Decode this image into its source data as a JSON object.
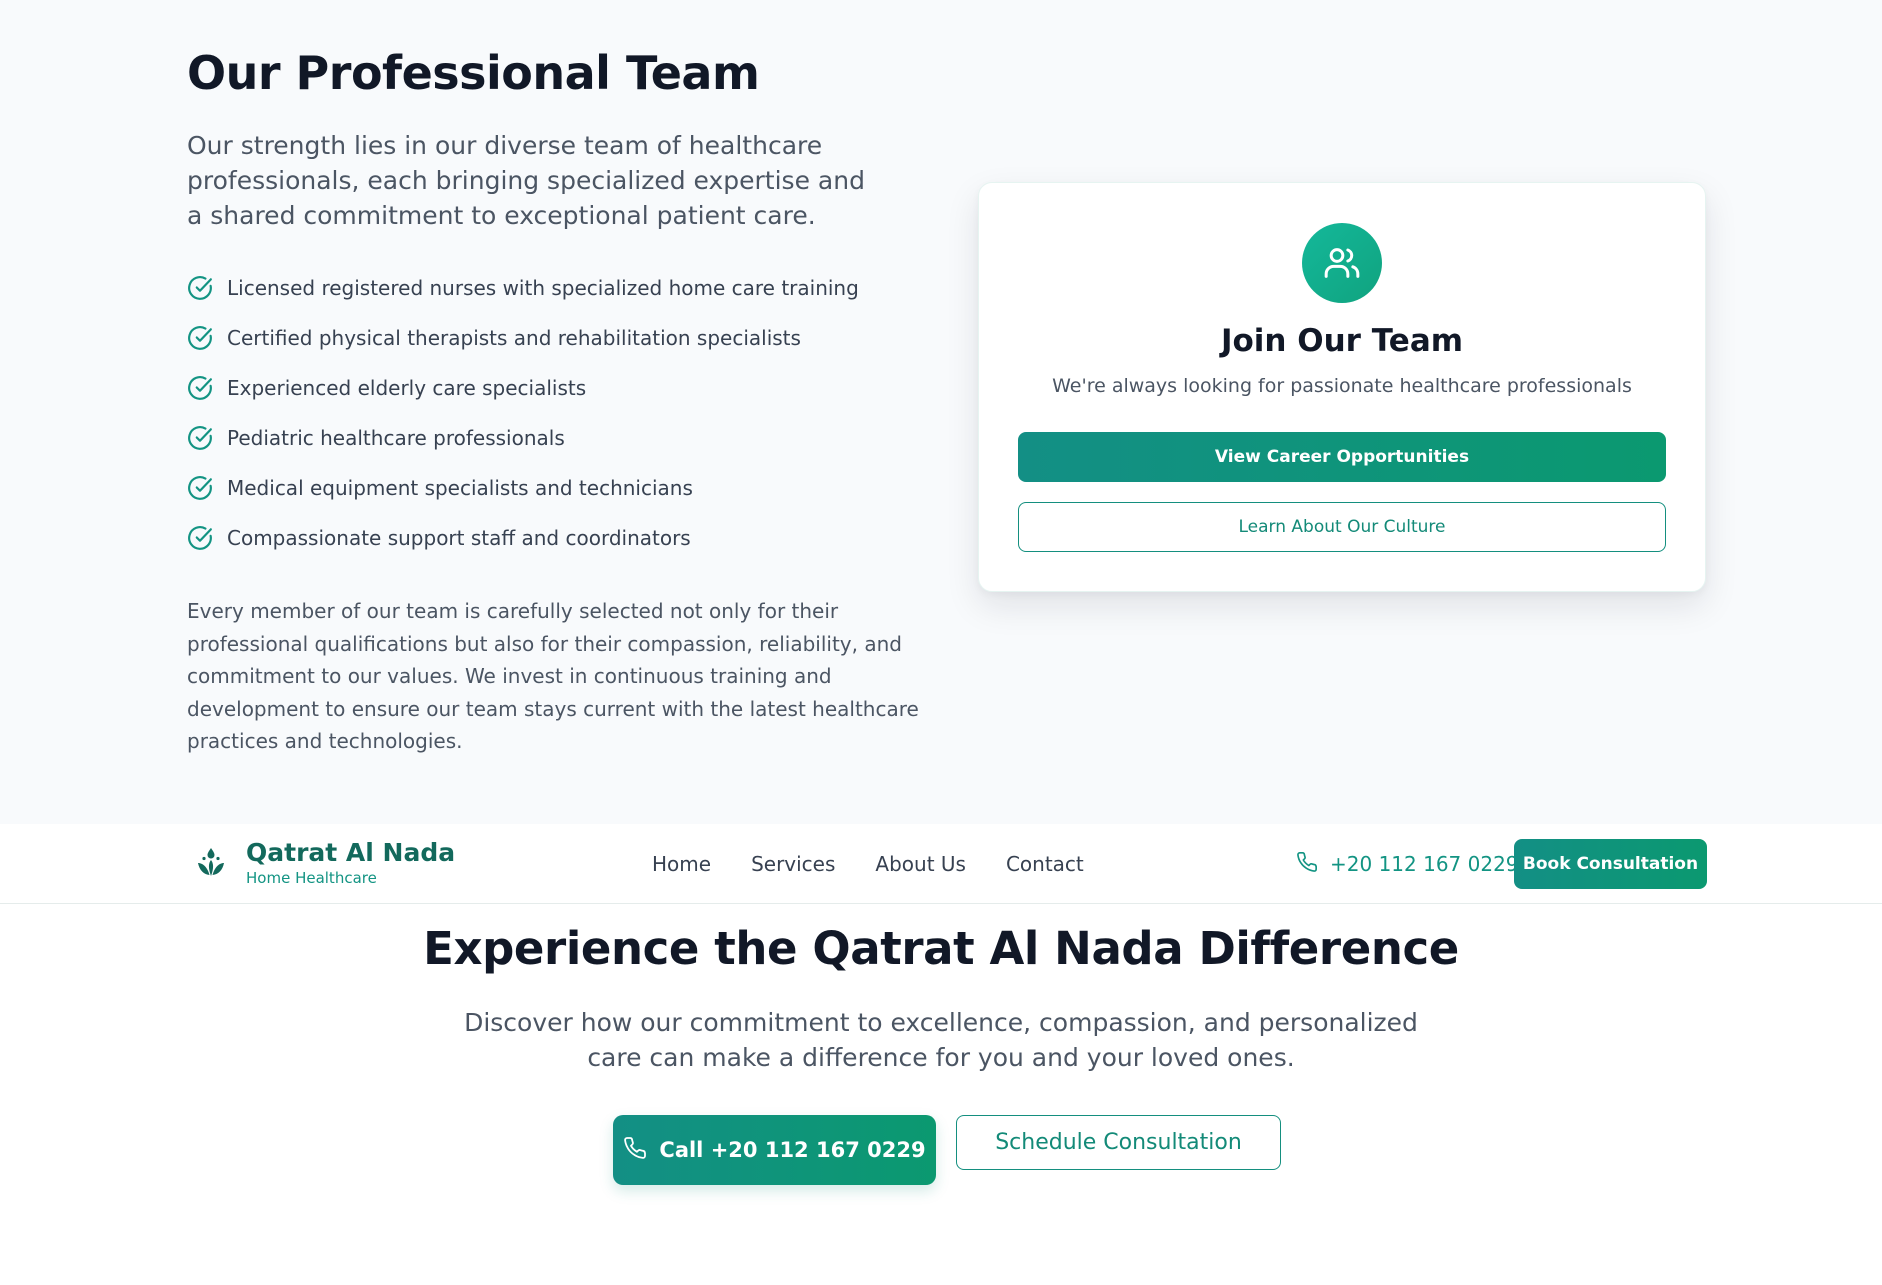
{
  "team": {
    "title": "Our Professional Team",
    "intro": "Our strength lies in our diverse team of healthcare professionals, each bringing specialized expertise and a shared commitment to exceptional patient care.",
    "features": [
      {
        "icon": "check-circle-icon",
        "text": "Licensed registered nurses with specialized home care training"
      },
      {
        "icon": "check-circle-icon",
        "text": "Certified physical therapists and rehabilitation specialists"
      },
      {
        "icon": "check-circle-icon",
        "text": "Experienced elderly care specialists"
      },
      {
        "icon": "check-circle-icon",
        "text": "Pediatric healthcare professionals"
      },
      {
        "icon": "check-circle-icon",
        "text": "Medical equipment specialists and technicians"
      },
      {
        "icon": "check-circle-icon",
        "text": "Compassionate support staff and coordinators"
      }
    ],
    "description": "Every member of our team is carefully selected not only for their professional qualifications but also for their compassion, reliability, and commitment to our values. We invest in continuous training and development to ensure our team stays current with the latest healthcare practices and technologies."
  },
  "join_card": {
    "icon": "users-icon",
    "title": "Join Our Team",
    "subtitle": "We're always looking for passionate healthcare professionals",
    "primary_button": "View Career Opportunities",
    "secondary_button": "Learn About Our Culture"
  },
  "navbar": {
    "logo_icon": "water-drop-lotus-icon",
    "brand_name": "Qatrat Al Nada",
    "brand_tagline": "Home Healthcare",
    "links": [
      "Home",
      "Services",
      "About Us",
      "Contact"
    ],
    "phone_icon": "phone-icon",
    "phone": "+20 112 167 0229",
    "book_button": "Book Consultation"
  },
  "cta": {
    "title": "Experience the Qatrat Al Nada Difference",
    "subtitle": "Discover how our commitment to excellence, compassion, and personalized care can make a difference for you and your loved ones.",
    "call_icon": "phone-icon",
    "call_button": "Call +20 112 167 0229",
    "schedule_button": "Schedule Consultation"
  },
  "colors": {
    "brand_teal": "#139483",
    "brand_teal_dark": "#13695c",
    "gradient_start": "#138f85",
    "gradient_end": "#0b9970",
    "heading": "#111827",
    "body_text": "#4b5563",
    "section_background": "#f8fafc"
  }
}
